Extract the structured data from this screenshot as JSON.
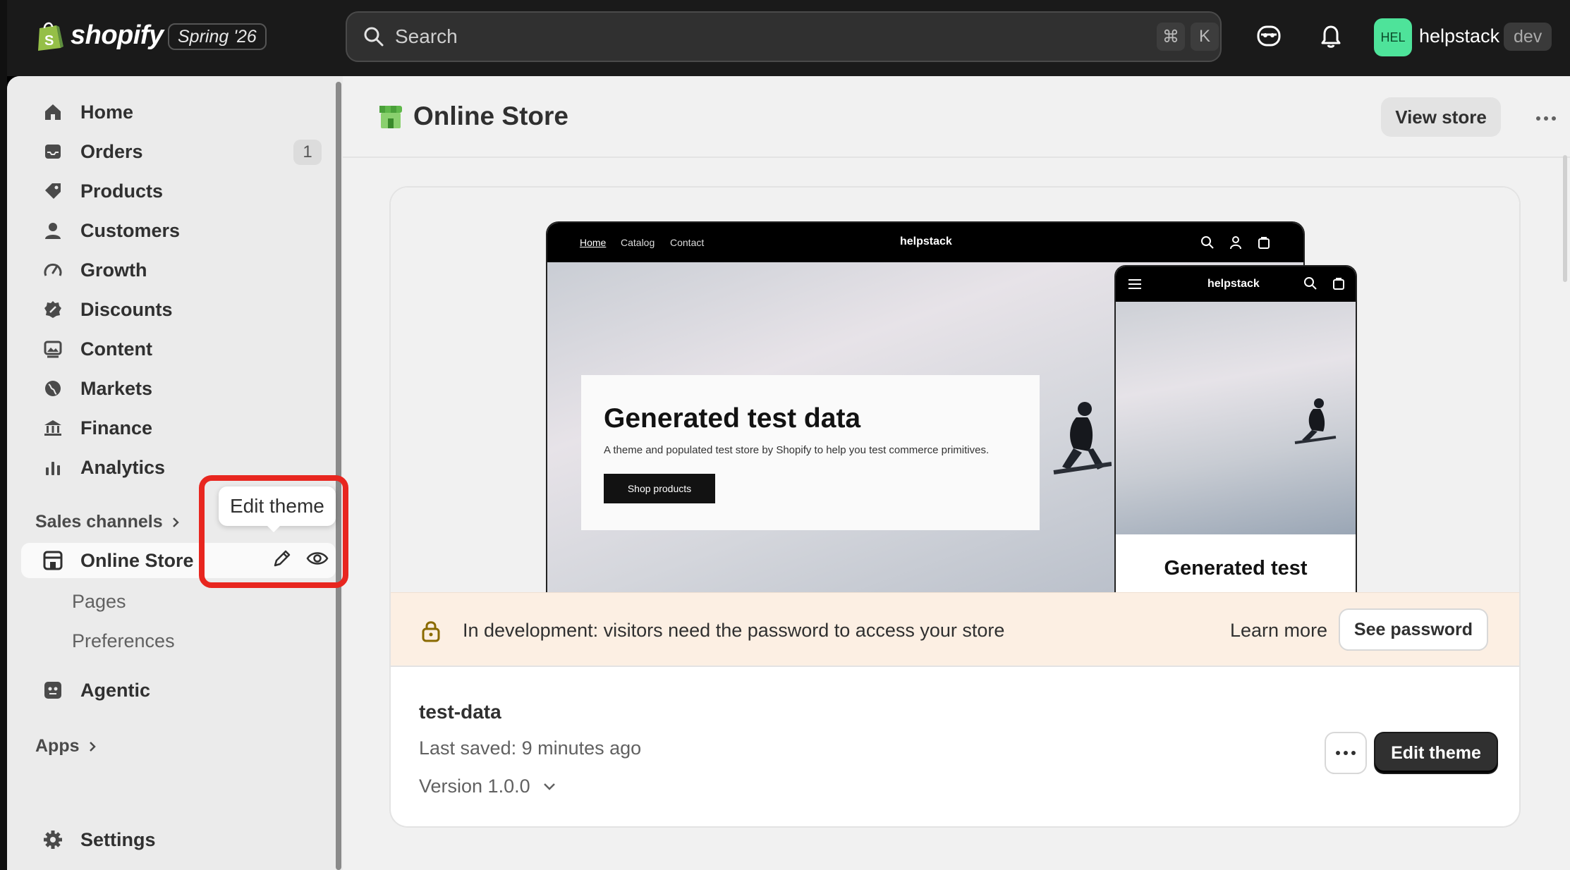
{
  "topbar": {
    "brand": "shopify",
    "edition": "Spring '26",
    "search": {
      "placeholder": "Search",
      "kbd1": "⌘",
      "kbd2": "K"
    },
    "avatar_initials": "HEL",
    "store_name": "helpstack",
    "env_badge": "dev"
  },
  "sidebar": {
    "items": [
      {
        "label": "Home"
      },
      {
        "label": "Orders",
        "count": "1"
      },
      {
        "label": "Products"
      },
      {
        "label": "Customers"
      },
      {
        "label": "Growth"
      },
      {
        "label": "Discounts"
      },
      {
        "label": "Content"
      },
      {
        "label": "Markets"
      },
      {
        "label": "Finance"
      },
      {
        "label": "Analytics"
      }
    ],
    "sales_channels_label": "Sales channels",
    "online_store_label": "Online Store",
    "sub_items": [
      {
        "label": "Pages"
      },
      {
        "label": "Preferences"
      }
    ],
    "agentic_label": "Agentic",
    "apps_label": "Apps",
    "settings_label": "Settings",
    "tooltip": "Edit theme"
  },
  "header": {
    "title": "Online Store",
    "view_store": "View store"
  },
  "preview": {
    "nav_links": [
      "Home",
      "Catalog",
      "Contact"
    ],
    "brand": "helpstack",
    "hero_title": "Generated test data",
    "hero_desc": "A theme and populated test store by Shopify to help you test commerce primitives.",
    "hero_button": "Shop products",
    "mobile_title": "Generated test"
  },
  "banner": {
    "text": "In development: visitors need the password to access your store",
    "learn_more": "Learn more",
    "see_password": "See password"
  },
  "theme": {
    "name": "test-data",
    "saved": "Last saved: 9 minutes ago",
    "version": "Version 1.0.0",
    "edit_button": "Edit theme"
  },
  "colors": {
    "highlight": "#e8261f",
    "avatar": "#4ee39a",
    "banner_bg": "#fcefe3",
    "primary_button": "#303030"
  }
}
